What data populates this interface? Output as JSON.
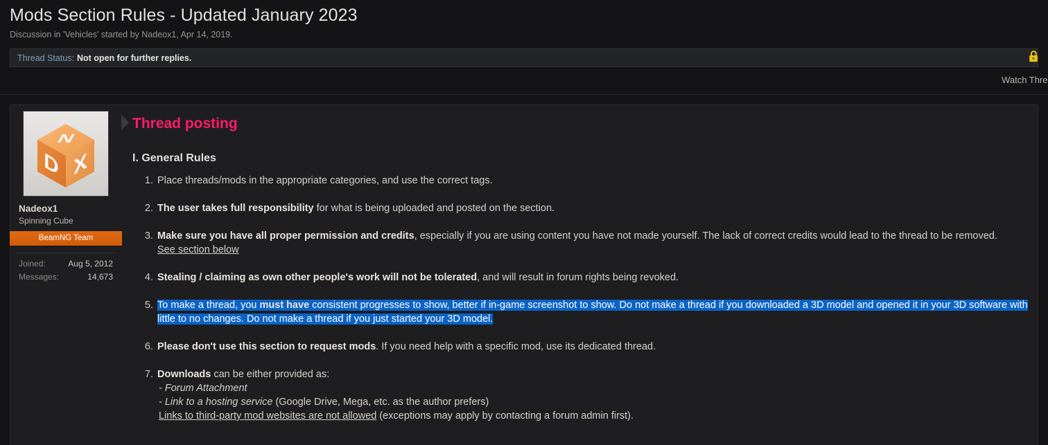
{
  "thread": {
    "title": "Mods Section Rules - Updated January 2023",
    "subtitle": "Discussion in 'Vehicles' started by Nadeox1, Apr 14, 2019.",
    "status_label": "Thread Status:",
    "status_value": "Not open for further replies.",
    "lock_icon": "lock-icon",
    "watch_thread": "Watch Thread"
  },
  "author": {
    "avatar_icon": "beamng-cube-avatar",
    "avatar_letters": [
      "N",
      "D",
      "X"
    ],
    "name": "Nadeox1",
    "title": "Spinning Cube",
    "banner": "BeamNG Team",
    "stats": [
      {
        "key": "Joined:",
        "value": "Aug 5, 2012"
      },
      {
        "key": "Messages:",
        "value": "14,673"
      }
    ]
  },
  "post": {
    "heading": "Thread posting",
    "section_heading": "I. General Rules",
    "rules": {
      "r1": "Place threads/mods in the appropriate categories, and use the correct tags.",
      "r2_bold": "The user takes full responsibility",
      "r2_rest": " for what is being uploaded and posted on the section.",
      "r3_bold": "Make sure you have all proper permission and credits",
      "r3_rest": ", especially if you are using content you have not made yourself. The lack of correct credits would lead to the thread to be removed.",
      "r3_link": "See section below",
      "r4_bold": "Stealing / claiming as own other people's work will not be tolerated",
      "r4_rest": ", and will result in forum rights being revoked.",
      "r5_a": "To make a thread, you ",
      "r5_bold": "must have",
      "r5_b": " consistent progresses to show, better if in-game screenshot to show. Do not make a thread if you downloaded a 3D model and opened it in your 3D software with little to no changes. Do not make a thread if you just started your 3D model.",
      "r6_bold": "Please don't use this section to request mods",
      "r6_rest": ". If you need help with a specific mod, use its dedicated thread.",
      "r7_bold": "Downloads",
      "r7_rest": " can be either provided as:",
      "r7_sub1": "- Forum Attachment",
      "r7_sub2_i": "- Link to a hosting service",
      "r7_sub2_rest": " (Google Drive, Mega, etc. as the author prefers)",
      "r7_sub3_u": "Links to third-party mod websites are not allowed",
      "r7_sub3_rest": " (exceptions may apply by contacting a forum admin first)."
    }
  },
  "colors": {
    "page_bg": "#141416",
    "post_bg": "#1e1e20",
    "accent_pink": "#ff1a6b",
    "banner_orange": "#dd6511",
    "selection_blue": "#0b63c7",
    "lock_yellow": "#e8c317"
  }
}
